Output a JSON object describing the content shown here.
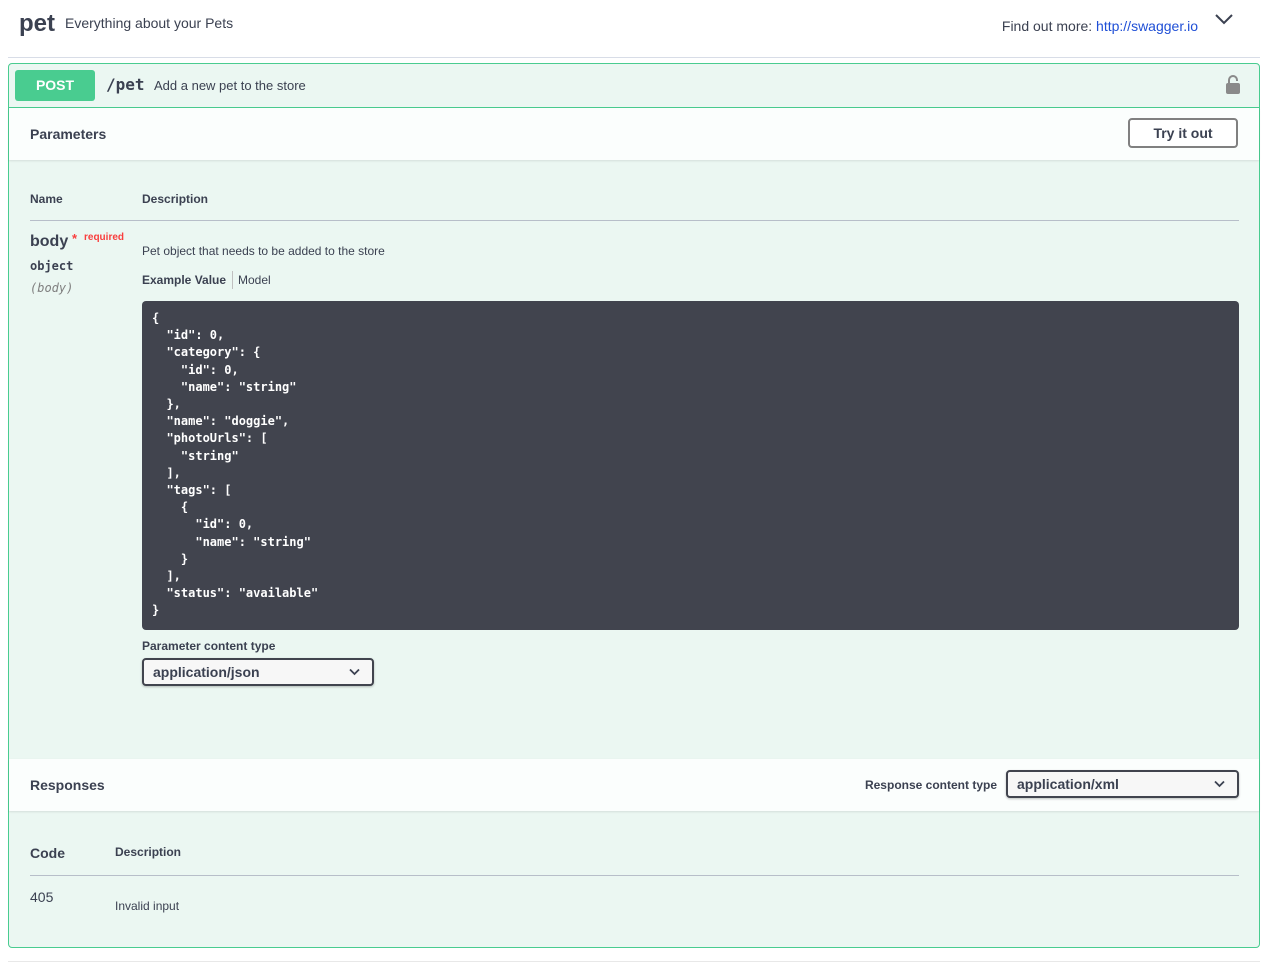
{
  "tag": {
    "name": "pet",
    "description": "Everything about your Pets",
    "find_out_more_label": "Find out more:",
    "find_out_more_link": "http://swagger.io"
  },
  "operation": {
    "method": "POST",
    "path": "/pet",
    "summary": "Add a new pet to the store",
    "method_color": "#49cc90"
  },
  "parameters": {
    "title": "Parameters",
    "try_button": "Try it out",
    "columns": {
      "name": "Name",
      "description": "Description"
    },
    "items": [
      {
        "name": "body",
        "required_star": "*",
        "required_label": "required",
        "type": "object",
        "in": "(body)",
        "description": "Pet object that needs to be added to the store",
        "tab_example": "Example Value",
        "tab_model": "Model",
        "example": "{\n  \"id\": 0,\n  \"category\": {\n    \"id\": 0,\n    \"name\": \"string\"\n  },\n  \"name\": \"doggie\",\n  \"photoUrls\": [\n    \"string\"\n  ],\n  \"tags\": [\n    {\n      \"id\": 0,\n      \"name\": \"string\"\n    }\n  ],\n  \"status\": \"available\"\n}"
      }
    ],
    "content_type_label": "Parameter content type",
    "content_type_value": "application/json"
  },
  "responses": {
    "title": "Responses",
    "content_type_label": "Response content type",
    "content_type_value": "application/xml",
    "columns": {
      "code": "Code",
      "description": "Description"
    },
    "items": [
      {
        "code": "405",
        "description": "Invalid input"
      }
    ]
  }
}
